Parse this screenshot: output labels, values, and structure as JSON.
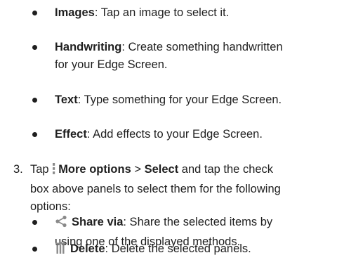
{
  "items": [
    {
      "term": "Images",
      "desc": ": Tap an image to select it."
    },
    {
      "term": "Handwriting",
      "desc": ": Create something handwritten",
      "desc2": "for your Edge Screen."
    },
    {
      "term": "Text",
      "desc": ": Type something for your Edge Screen."
    },
    {
      "term": "Effect",
      "desc": ": Add effects to your Edge Screen."
    }
  ],
  "step3": {
    "number": "3.",
    "line1_pre": "Tap ",
    "more_options": "More options",
    "sep": " > ",
    "select": "Select",
    "line1_post": " and tap the check",
    "line2": "box above panels to select them for the following",
    "line3": "options:"
  },
  "subitems": [
    {
      "icon": "share-icon",
      "term": "Share via",
      "desc": ": Share the selected items by",
      "desc2": "using one of the displayed methods."
    },
    {
      "icon": "trash-icon",
      "term": "Delete",
      "desc": ": Delete the selected panels."
    }
  ],
  "colors": {
    "text": "#1f1f1f",
    "icon": "#8a8a8a"
  }
}
